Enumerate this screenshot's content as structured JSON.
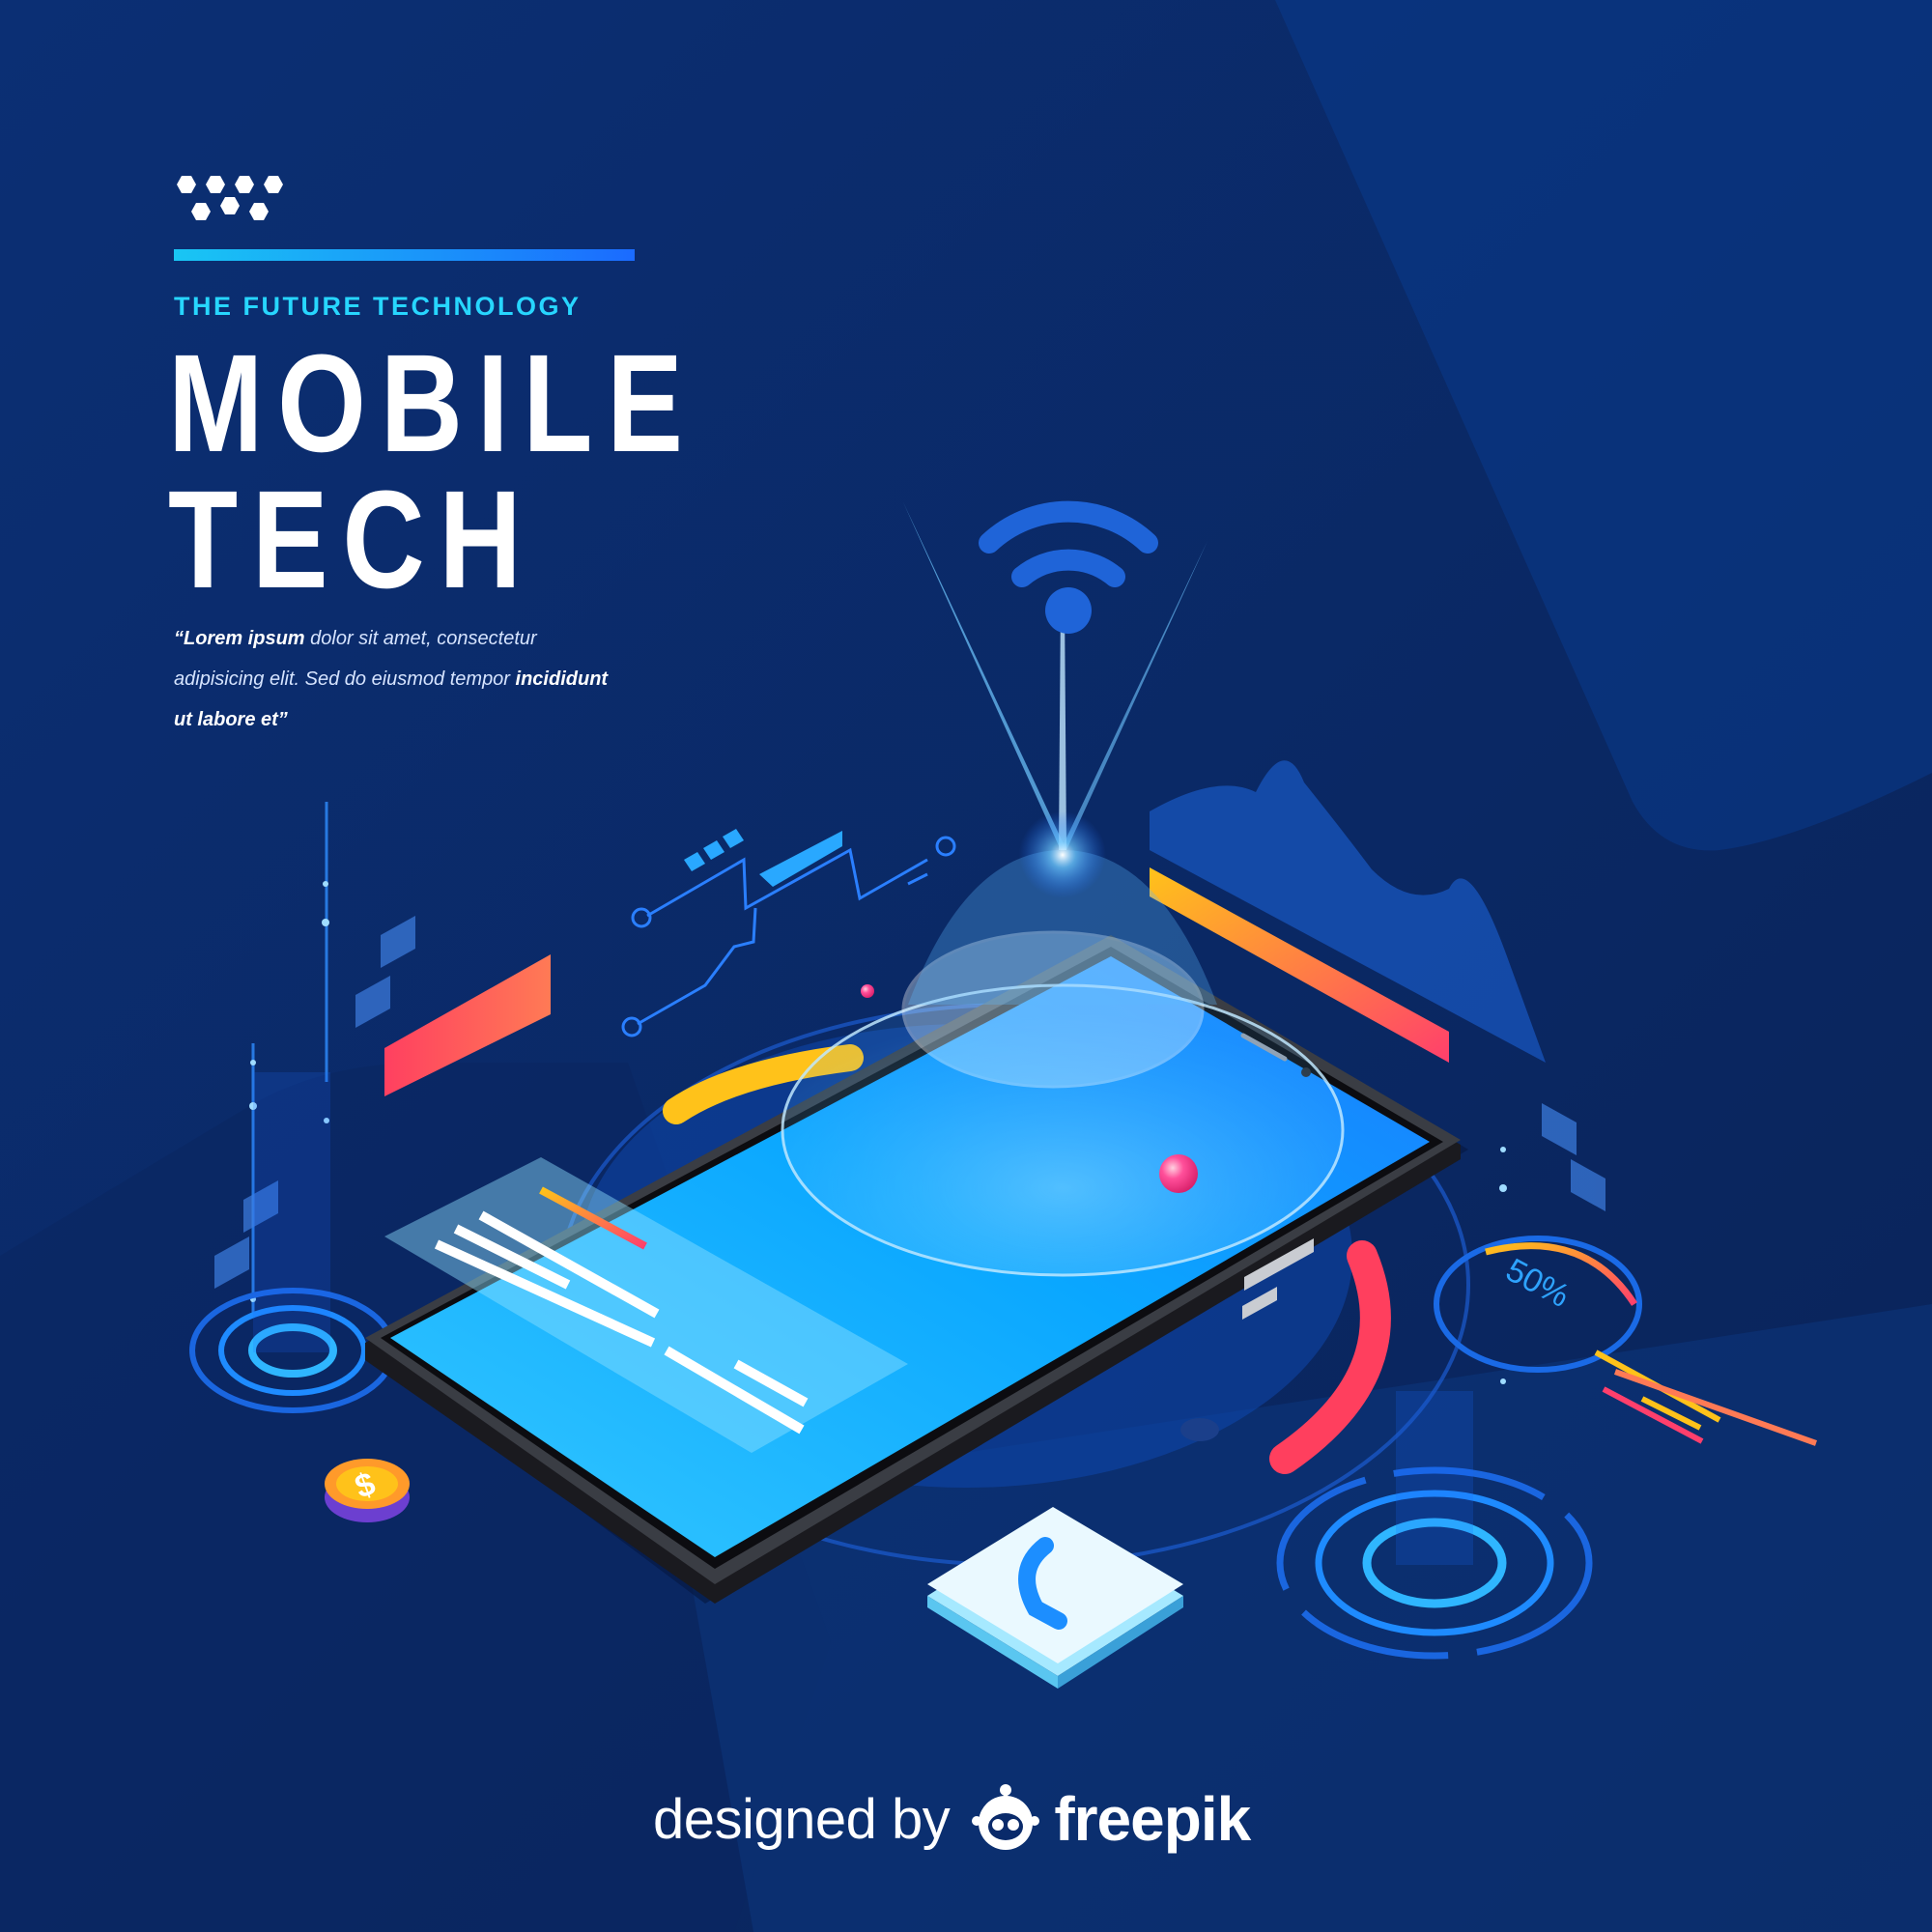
{
  "header": {
    "eyebrow": "THE FUTURE TECHNOLOGY",
    "title_line1": "MOBILE",
    "title_line2": "TECH"
  },
  "quote": {
    "p1_bold": "“Lorem ipsum",
    "p1_text": " dolor sit amet, consectetur",
    "p2_text": "adipisicing elit. Sed do eiusmod tempor ",
    "p2_bold": "incididunt",
    "p3_bold": "ut labore et”"
  },
  "gauge_label": "50%",
  "coin_symbol": "$",
  "credit": {
    "prefix": "designed by",
    "brand": "freepik"
  },
  "icons": [
    "hexagon-icon",
    "wifi-icon",
    "phone-call-icon",
    "dollar-coin-icon",
    "freepik-logo-icon"
  ],
  "colors": {
    "background": "#0a2a6a",
    "accent_cyan": "#27d6ff",
    "accent_blue": "#1b6bff",
    "screen_blue": "#19b4ff",
    "accent_red": "#ff3f5e",
    "accent_yellow": "#ffc21a"
  }
}
